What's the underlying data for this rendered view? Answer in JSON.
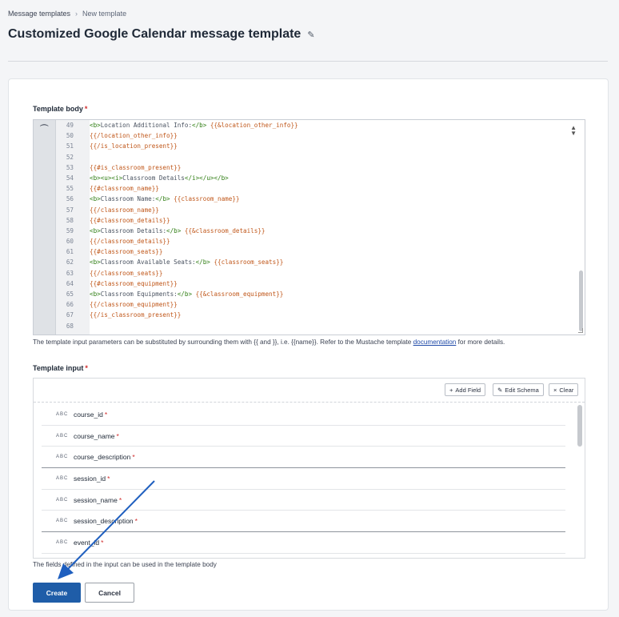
{
  "breadcrumb": {
    "parent": "Message templates",
    "current": "New template"
  },
  "page": {
    "title": "Customized Google Calendar message template"
  },
  "template_body": {
    "label": "Template body",
    "required_mark": "*",
    "lines": [
      {
        "n": "49",
        "parts": [
          [
            "tag",
            "<b>"
          ],
          [
            "plain",
            "Location Additional Info:"
          ],
          [
            "tag",
            "</b>"
          ],
          [
            "plain",
            " "
          ],
          [
            "mus",
            "{{&location_other_info}}"
          ]
        ]
      },
      {
        "n": "50",
        "parts": [
          [
            "mus",
            "{{/location_other_info}}"
          ]
        ]
      },
      {
        "n": "51",
        "parts": [
          [
            "mus",
            "{{/is_location_present}}"
          ]
        ]
      },
      {
        "n": "52",
        "parts": []
      },
      {
        "n": "53",
        "parts": [
          [
            "mus",
            "{{#is_classroom_present}}"
          ]
        ]
      },
      {
        "n": "54",
        "parts": [
          [
            "tag",
            "<b><u><i>"
          ],
          [
            "plain",
            "Classroom Details"
          ],
          [
            "tag",
            "</i></u></b>"
          ]
        ]
      },
      {
        "n": "55",
        "parts": [
          [
            "mus",
            "{{#classroom_name}}"
          ]
        ]
      },
      {
        "n": "56",
        "parts": [
          [
            "tag",
            "<b>"
          ],
          [
            "plain",
            "Classroom Name:"
          ],
          [
            "tag",
            "</b>"
          ],
          [
            "plain",
            " "
          ],
          [
            "mus",
            "{{classroom_name}}"
          ]
        ]
      },
      {
        "n": "57",
        "parts": [
          [
            "mus",
            "{{/classroom_name}}"
          ]
        ]
      },
      {
        "n": "58",
        "parts": [
          [
            "mus",
            "{{#classroom_details}}"
          ]
        ]
      },
      {
        "n": "59",
        "parts": [
          [
            "tag",
            "<b>"
          ],
          [
            "plain",
            "Classroom Details:"
          ],
          [
            "tag",
            "</b>"
          ],
          [
            "plain",
            " "
          ],
          [
            "mus",
            "{{&classroom_details}}"
          ]
        ]
      },
      {
        "n": "60",
        "parts": [
          [
            "mus",
            "{{/classroom_details}}"
          ]
        ]
      },
      {
        "n": "61",
        "parts": [
          [
            "mus",
            "{{#classroom_seats}}"
          ]
        ]
      },
      {
        "n": "62",
        "parts": [
          [
            "tag",
            "<b>"
          ],
          [
            "plain",
            "Classroom Available Seats:"
          ],
          [
            "tag",
            "</b>"
          ],
          [
            "plain",
            " "
          ],
          [
            "mus",
            "{{classroom_seats}}"
          ]
        ]
      },
      {
        "n": "63",
        "parts": [
          [
            "mus",
            "{{/classroom_seats}}"
          ]
        ]
      },
      {
        "n": "64",
        "parts": [
          [
            "mus",
            "{{#classroom_equipment}}"
          ]
        ]
      },
      {
        "n": "65",
        "parts": [
          [
            "tag",
            "<b>"
          ],
          [
            "plain",
            "Classroom Equipments:"
          ],
          [
            "tag",
            "</b>"
          ],
          [
            "plain",
            " "
          ],
          [
            "mus",
            "{{&classroom_equipment}}"
          ]
        ]
      },
      {
        "n": "66",
        "parts": [
          [
            "mus",
            "{{/classroom_equipment}}"
          ]
        ]
      },
      {
        "n": "67",
        "parts": [
          [
            "mus",
            "{{/is_classroom_present}}"
          ]
        ]
      },
      {
        "n": "68",
        "parts": []
      }
    ],
    "hint_before": "The template input parameters can be substituted by surrounding them with {{ and }}, i.e. {{name}}. Refer to the Mustache template ",
    "hint_link": "documentation",
    "hint_after": " for more details."
  },
  "template_input": {
    "label": "Template input",
    "required_mark": "*",
    "toolbar": {
      "add_field": "Add Field",
      "edit_schema": "Edit Schema",
      "clear": "Clear"
    },
    "type_badge": "ABC",
    "fields": [
      {
        "name": "course_id",
        "required": "*"
      },
      {
        "name": "course_name",
        "required": "*"
      },
      {
        "name": "course_description",
        "required": "*"
      },
      {
        "name": "session_id",
        "required": "*"
      },
      {
        "name": "session_name",
        "required": "*"
      },
      {
        "name": "session_description",
        "required": "*"
      },
      {
        "name": "event_id",
        "required": "*"
      }
    ],
    "hint": "The fields defined in the input can be used in the template body"
  },
  "actions": {
    "create": "Create",
    "cancel": "Cancel"
  },
  "colors": {
    "primary": "#1f5da8",
    "arrow": "#1f5fbf",
    "required": "#d12c2c"
  }
}
